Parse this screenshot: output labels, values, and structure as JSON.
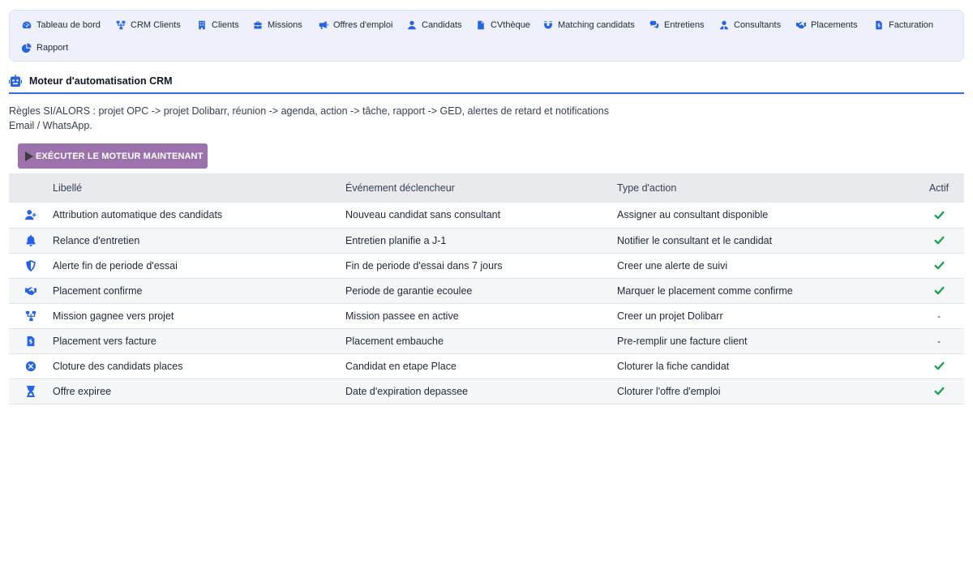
{
  "nav": {
    "items": [
      {
        "label": "Tableau de bord",
        "icon": "dashboard-icon"
      },
      {
        "label": "CRM Clients",
        "icon": "sitemap-icon"
      },
      {
        "label": "Clients",
        "icon": "building-icon"
      },
      {
        "label": "Missions",
        "icon": "briefcase-icon"
      },
      {
        "label": "Offres d'emploi",
        "icon": "megaphone-icon"
      },
      {
        "label": "Candidats",
        "icon": "user-icon"
      },
      {
        "label": "CVthèque",
        "icon": "file-icon"
      },
      {
        "label": "Matching candidats",
        "icon": "magnet-icon"
      },
      {
        "label": "Entretiens",
        "icon": "comments-icon"
      },
      {
        "label": "Consultants",
        "icon": "user-tie-icon"
      },
      {
        "label": "Placements",
        "icon": "handshake-icon"
      },
      {
        "label": "Facturation",
        "icon": "invoice-icon"
      },
      {
        "label": "Rapport",
        "icon": "pie-chart-icon"
      }
    ]
  },
  "header": {
    "title": "Moteur d'automatisation CRM",
    "icon": "robot-icon",
    "description": "Règles SI/ALORS : projet OPC -> projet Dolibarr, réunion -> agenda, action -> tâche, rapport -> GED, alertes de retard et notifications Email / WhatsApp."
  },
  "run_button": {
    "label": "EXÉCUTER LE MOTEUR MAINTENANT",
    "icon": "play-icon",
    "color": "#9b72ab"
  },
  "table": {
    "columns": {
      "label": "Libellé",
      "event": "Événement déclencheur",
      "action": "Type d'action",
      "active": "Actif"
    },
    "rows": [
      {
        "icon": "user-plus-icon",
        "label": "Attribution automatique des candidats",
        "event": "Nouveau candidat sans consultant",
        "action": "Assigner au consultant disponible",
        "active": true
      },
      {
        "icon": "bell-icon",
        "label": "Relance d'entretien",
        "event": "Entretien planifie a J-1",
        "action": "Notifier le consultant et le candidat",
        "active": true
      },
      {
        "icon": "shield-icon",
        "label": "Alerte fin de periode d'essai",
        "event": "Fin de periode d'essai dans 7 jours",
        "action": "Creer une alerte de suivi",
        "active": true
      },
      {
        "icon": "handshake-icon",
        "label": "Placement confirme",
        "event": "Periode de garantie ecoulee",
        "action": "Marquer le placement comme confirme",
        "active": true
      },
      {
        "icon": "sitemap-icon",
        "label": "Mission gagnee vers projet",
        "event": "Mission passee en active",
        "action": "Creer un projet Dolibarr",
        "active": false,
        "inactive_mark": "-"
      },
      {
        "icon": "invoice-icon",
        "label": "Placement vers facture",
        "event": "Placement embauche",
        "action": "Pre-remplir une facture client",
        "active": false,
        "inactive_mark": "-"
      },
      {
        "icon": "circle-x-icon",
        "label": "Cloture des candidats places",
        "event": "Candidat en etape Place",
        "action": "Cloturer la fiche candidat",
        "active": true
      },
      {
        "icon": "hourglass-icon",
        "label": "Offre expiree",
        "event": "Date d'expiration depassee",
        "action": "Cloturer l'offre d'emploi",
        "active": true
      }
    ]
  },
  "colors": {
    "accent": "#2563eb",
    "check": "#16a34a",
    "header_rule": "#2f6fdb"
  }
}
